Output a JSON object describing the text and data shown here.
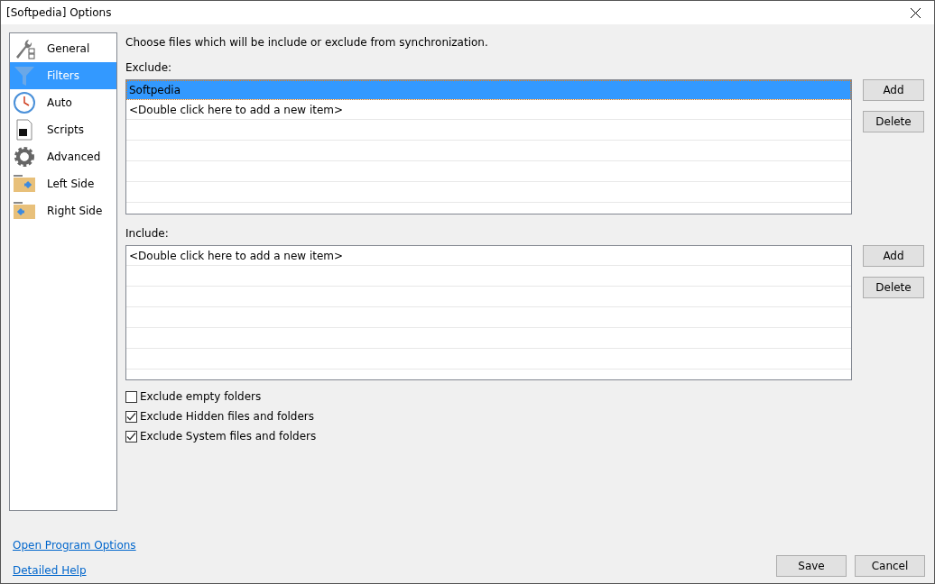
{
  "window": {
    "title": "[Softpedia] Options"
  },
  "sidebar": {
    "items": [
      {
        "label": "General",
        "kind": "general",
        "selected": false
      },
      {
        "label": "Filters",
        "kind": "filters",
        "selected": true
      },
      {
        "label": "Auto",
        "kind": "auto",
        "selected": false
      },
      {
        "label": "Scripts",
        "kind": "scripts",
        "selected": false
      },
      {
        "label": "Advanced",
        "kind": "advanced",
        "selected": false
      },
      {
        "label": "Left Side",
        "kind": "left",
        "selected": false
      },
      {
        "label": "Right Side",
        "kind": "right",
        "selected": false
      }
    ]
  },
  "intro": "Choose files which will be include or exclude from synchronization.",
  "lists": [
    {
      "label": "Exclude:",
      "items": [
        {
          "text": "Softpedia",
          "selected": true
        },
        {
          "text": "<Double click here to add a new item>",
          "selected": false
        }
      ],
      "buttons": [
        "Add",
        "Delete"
      ]
    },
    {
      "label": "Include:",
      "items": [
        {
          "text": "<Double click here to add a new item>",
          "selected": false
        }
      ],
      "buttons": [
        "Add",
        "Delete"
      ]
    }
  ],
  "options": [
    {
      "label": "Exclude empty folders",
      "checked": false
    },
    {
      "label": "Exclude Hidden files and folders",
      "checked": true
    },
    {
      "label": "Exclude System files and folders",
      "checked": true
    }
  ],
  "links": [
    "Open Program Options",
    "Detailed Help"
  ],
  "buttons": [
    "Save",
    "Cancel"
  ]
}
